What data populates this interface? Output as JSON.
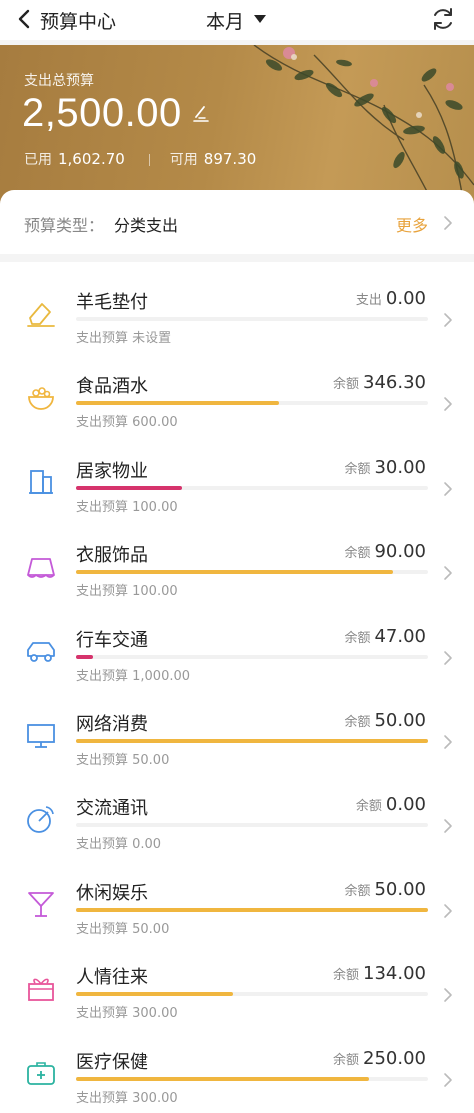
{
  "header": {
    "title": "预算中心",
    "period": "本月"
  },
  "hero": {
    "label": "支出总预算",
    "amount": "2,500.00",
    "used_label": "已用",
    "used": "1,602.70",
    "available_label": "可用",
    "available": "897.30"
  },
  "type": {
    "label": "预算类型：",
    "value": "分类支出",
    "more": "更多"
  },
  "categories": [
    {
      "name": "羊毛垫付",
      "right_label": "支出",
      "amount": "0.00",
      "sub": "支出预算 未设置",
      "progress": 0,
      "bar_color": "#f0c060",
      "icon": "eraser-icon",
      "icon_color": "#e9b93f"
    },
    {
      "name": "食品酒水",
      "right_label": "余额",
      "amount": "346.30",
      "sub": "支出预算 600.00",
      "progress": 0.577,
      "bar_color": "#f0b63f",
      "icon": "food-bowl-icon",
      "icon_color": "#f0b63f"
    },
    {
      "name": "居家物业",
      "right_label": "余额",
      "amount": "30.00",
      "sub": "支出预算 100.00",
      "progress": 0.3,
      "bar_color": "#d6336c",
      "icon": "building-icon",
      "icon_color": "#4a90e2"
    },
    {
      "name": "衣服饰品",
      "right_label": "余额",
      "amount": "90.00",
      "sub": "支出预算 100.00",
      "progress": 0.9,
      "bar_color": "#f0b63f",
      "icon": "skirt-icon",
      "icon_color": "#c45ad8"
    },
    {
      "name": "行车交通",
      "right_label": "余额",
      "amount": "47.00",
      "sub": "支出预算 1,000.00",
      "progress": 0.047,
      "bar_color": "#d6336c",
      "icon": "car-icon",
      "icon_color": "#4a90e2"
    },
    {
      "name": "网络消费",
      "right_label": "余额",
      "amount": "50.00",
      "sub": "支出预算 50.00",
      "progress": 1.0,
      "bar_color": "#f0b63f",
      "icon": "monitor-icon",
      "icon_color": "#4a90e2"
    },
    {
      "name": "交流通讯",
      "right_label": "余额",
      "amount": "0.00",
      "sub": "支出预算 0.00",
      "progress": 0,
      "bar_color": "#f0b63f",
      "icon": "satellite-icon",
      "icon_color": "#4a90e2"
    },
    {
      "name": "休闲娱乐",
      "right_label": "余额",
      "amount": "50.00",
      "sub": "支出预算 50.00",
      "progress": 1.0,
      "bar_color": "#f0b63f",
      "icon": "cocktail-icon",
      "icon_color": "#c45ad8"
    },
    {
      "name": "人情往来",
      "right_label": "余额",
      "amount": "134.00",
      "sub": "支出预算 300.00",
      "progress": 0.447,
      "bar_color": "#f0b63f",
      "icon": "gift-icon",
      "icon_color": "#e8559a"
    },
    {
      "name": "医疗保健",
      "right_label": "余额",
      "amount": "250.00",
      "sub": "支出预算 300.00",
      "progress": 0.833,
      "bar_color": "#f0b63f",
      "icon": "medical-kit-icon",
      "icon_color": "#2bb3a0"
    }
  ]
}
